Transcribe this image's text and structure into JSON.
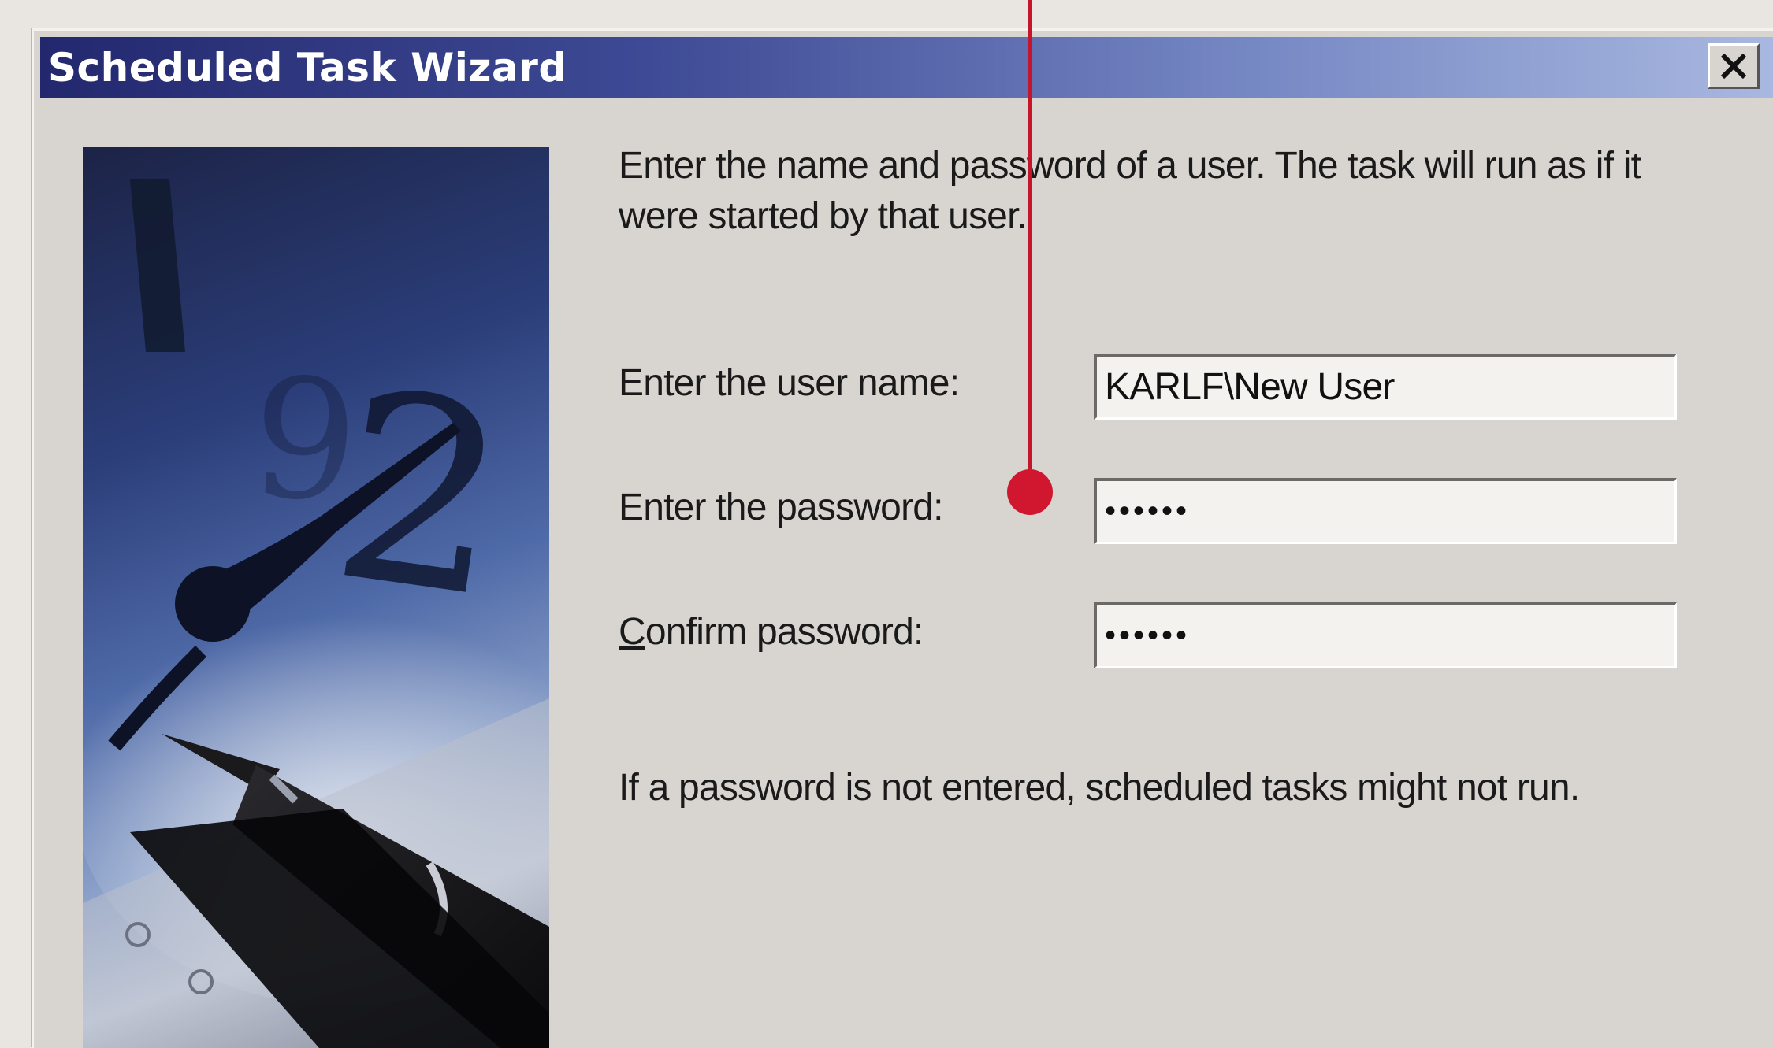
{
  "window": {
    "title": "Scheduled Task Wizard",
    "close_icon": "close-icon"
  },
  "wizard": {
    "picture": "clock-and-fountain-pen-illustration",
    "intro": "Enter the name and password of a user.  The task will run as if it were started by that user.",
    "username_label": "Enter the user name:",
    "username_value": "KARLF\\New User",
    "password_label": "Enter the password:",
    "password_value": "••••••",
    "confirm_label_accesskey": "C",
    "confirm_label_rest": "onfirm password:",
    "confirm_value": "••••••",
    "note": "If a password is not entered, scheduled tasks might not run."
  },
  "callout": {
    "color": "#d1172f"
  },
  "colors": {
    "title_gradient_start": "#23286e",
    "title_gradient_end": "#a9b8e0",
    "dialog_face": "#d8d5d0"
  }
}
